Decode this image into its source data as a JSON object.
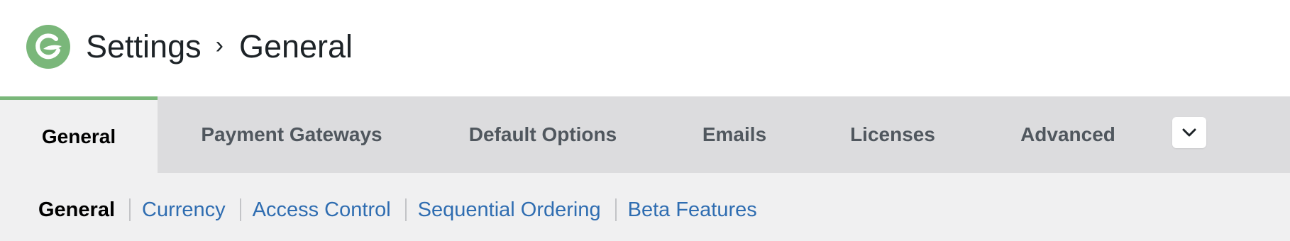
{
  "header": {
    "logo_icon": "give-logo-icon",
    "breadcrumb_root": "Settings",
    "breadcrumb_separator": "›",
    "breadcrumb_current": "General",
    "brand_color": "#7ab77a"
  },
  "tabs": [
    {
      "label": "General",
      "active": true
    },
    {
      "label": "Payment Gateways",
      "active": false
    },
    {
      "label": "Default Options",
      "active": false
    },
    {
      "label": "Emails",
      "active": false
    },
    {
      "label": "Licenses",
      "active": false
    },
    {
      "label": "Advanced",
      "active": false
    }
  ],
  "more_tabs_icon": "chevron-down-icon",
  "subnav": [
    {
      "label": "General",
      "current": true
    },
    {
      "label": "Currency",
      "current": false
    },
    {
      "label": "Access Control",
      "current": false
    },
    {
      "label": "Sequential Ordering",
      "current": false
    },
    {
      "label": "Beta Features",
      "current": false
    }
  ],
  "colors": {
    "link": "#2f6db1",
    "tab_bar": "#dcdcde",
    "active_tab_indicator": "#7ab77a"
  }
}
